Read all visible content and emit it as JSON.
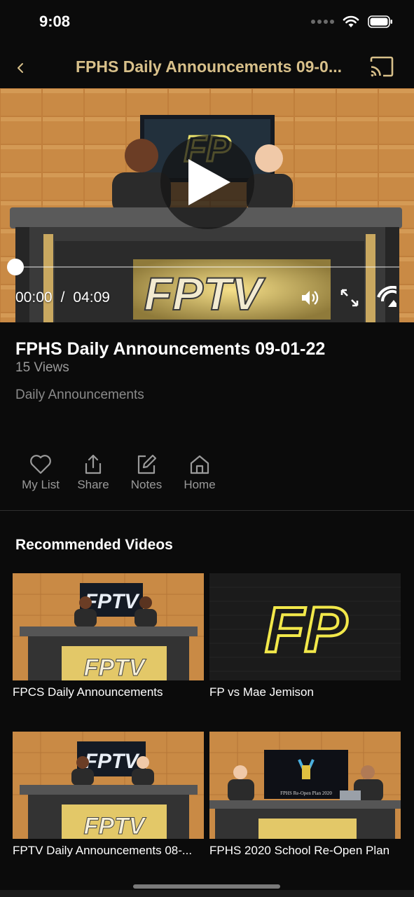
{
  "status_bar": {
    "time": "9:08"
  },
  "nav": {
    "title": "FPHS Daily Announcements 09-0..."
  },
  "player": {
    "current_time": "00:00",
    "separator": "/",
    "duration": "04:09",
    "progress": 0,
    "desk_text": "FPTV",
    "screen_text": "FP"
  },
  "video": {
    "title": "FPHS Daily Announcements 09-01-22",
    "views": "15 Views",
    "category": "Daily Announcements"
  },
  "actions": [
    {
      "label": "My List",
      "icon": "heart-icon"
    },
    {
      "label": "Share",
      "icon": "share-icon"
    },
    {
      "label": "Notes",
      "icon": "edit-icon"
    },
    {
      "label": "Home",
      "icon": "home-icon"
    }
  ],
  "recommended": {
    "heading": "Recommended Videos",
    "items": [
      {
        "title": "FPCS Daily Announcements",
        "thumb_text": "FPTV"
      },
      {
        "title": "FP vs Mae Jemison",
        "thumb_text": "FP"
      },
      {
        "title": "FPTV Daily Announcements 08-...",
        "thumb_text": "FPTV"
      },
      {
        "title": "FPHS 2020 School Re-Open Plan",
        "thumb_text": "FPHS Re-Open Plan 2020"
      }
    ]
  },
  "colors": {
    "accent_gold": "#d8c08a",
    "background": "#0b0b0b",
    "muted_text": "#9a9a9a"
  }
}
